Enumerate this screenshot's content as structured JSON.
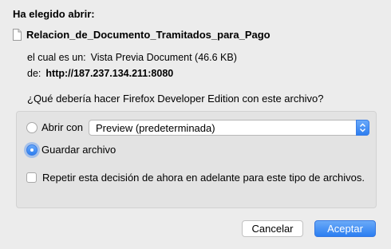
{
  "dialog": {
    "heading": "Ha elegido abrir:",
    "file_name": "Relacion_de_Documento_Tramitados_para_Pago",
    "type_label": "el cual es un:",
    "type_value": "Vista Previa Document (46.6 KB)",
    "from_label": "de:",
    "from_value": "http://187.237.134.211:8080",
    "question": "¿Qué debería hacer Firefox Developer Edition con este archivo?"
  },
  "options": {
    "open_with_label": "Abrir con",
    "open_with_selected": "Preview (predeterminada)",
    "open_with_checked": false,
    "save_label": "Guardar archivo",
    "save_checked": true,
    "remember_label": "Repetir esta decisión de ahora en adelante para este tipo de archivos.",
    "remember_checked": false
  },
  "buttons": {
    "cancel": "Cancelar",
    "accept": "Aceptar"
  },
  "colors": {
    "accent": "#2d7ef0",
    "background": "#ececec",
    "group_background": "#e3e3e3"
  },
  "icons": {
    "file": "document-icon",
    "select_arrow": "updown-chevron-icon"
  }
}
